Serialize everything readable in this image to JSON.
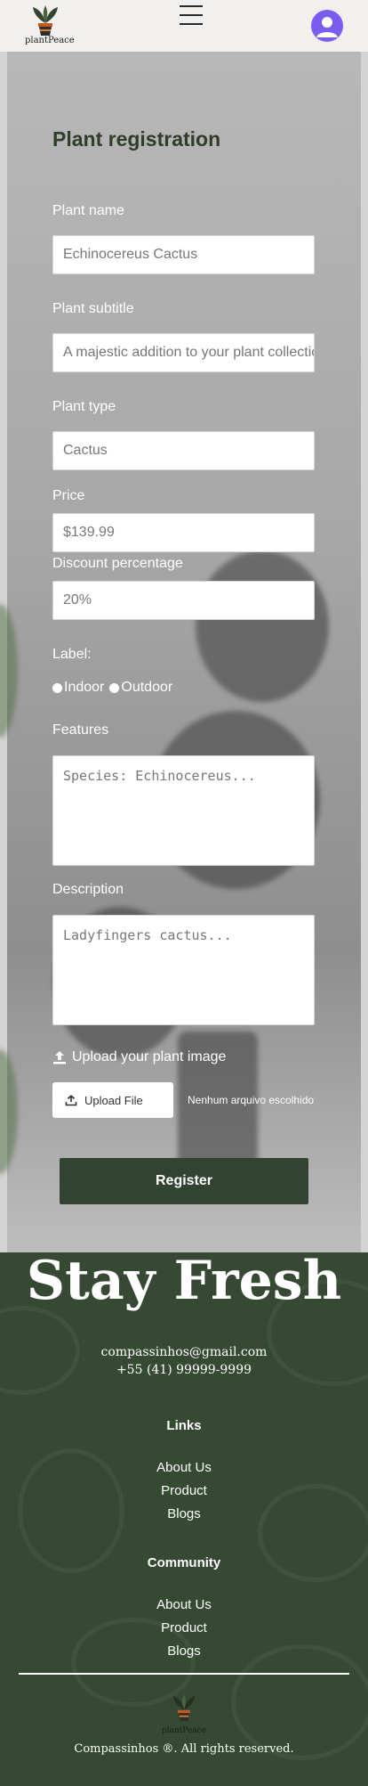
{
  "header": {
    "logo_text": "plantPeace"
  },
  "form": {
    "title": "Plant registration",
    "name_label": "Plant name",
    "name_value": "Echinocereus Cactus",
    "subtitle_label": "Plant subtitle",
    "subtitle_value": "A majestic addition to your plant collection",
    "type_label": "Plant type",
    "type_value": "Cactus",
    "price_label": "Price",
    "price_value": "$139.99",
    "discount_label": "Discount percentage",
    "discount_value": "20%",
    "label_label": "Label:",
    "radio_indoor": "Indoor",
    "radio_outdoor": "Outdoor",
    "features_label": "Features",
    "features_placeholder": "Species: Echinocereus...",
    "description_label": "Description",
    "description_placeholder": "Ladyfingers cactus...",
    "upload_label": "Upload your plant image",
    "upload_button": "Upload File",
    "no_file": "Nenhum arquivo escolhido",
    "register_button": "Register"
  },
  "footer": {
    "headline": "Stay Fresh",
    "email": "compassinhos@gmail.com",
    "phone": "+55 (41) 99999-9999",
    "links_heading": "Links",
    "links": [
      "About Us",
      "Product",
      "Blogs"
    ],
    "community_heading": "Community",
    "community": [
      "About Us",
      "Product",
      "Blogs"
    ],
    "logo_text": "plantPeace",
    "copyright": "Compassinhos ®. All rights reserved."
  },
  "colors": {
    "brand_green": "#334331",
    "footer_green": "#364933",
    "avatar": "#7b5cf0"
  }
}
